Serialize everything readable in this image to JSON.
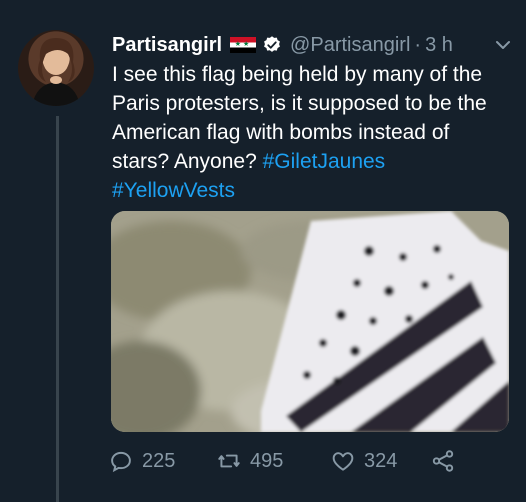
{
  "tweet": {
    "display_name": "Partisangirl",
    "handle": "@Partisangirl",
    "separator": "·",
    "time": "3 h",
    "text_part1": "I see this flag being held by many of the Paris protesters, is it supposed to be the American flag with bombs instead of stars? Anyone?",
    "hashtag1": "#GiletJaunes",
    "hashtag2": "#YellowVests"
  },
  "actions": {
    "replies": "225",
    "retweets": "495",
    "likes": "324"
  },
  "colors": {
    "background": "#15202b",
    "secondary_text": "#8899a6",
    "link": "#1da1f2",
    "thread_line": "#38444d"
  },
  "icons": {
    "reply": "reply-icon",
    "retweet": "retweet-icon",
    "like": "heart-icon",
    "share": "share-icon",
    "verified": "verified-badge-icon",
    "menu": "chevron-down-icon",
    "flag": "syria-flag-emoji"
  }
}
